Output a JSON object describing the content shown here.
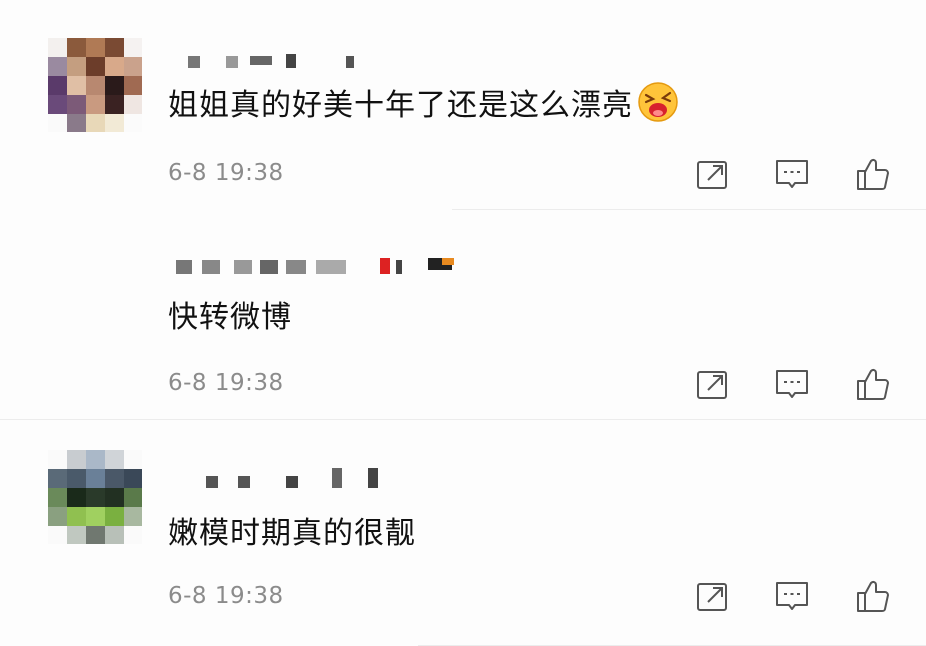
{
  "comments": [
    {
      "text": "姐姐真的好美十年了还是这么漂亮",
      "time": "6-8 19:38",
      "emoji": "laughing-face",
      "has_avatar": true
    },
    {
      "text": "快转微博",
      "time": "6-8 19:38",
      "has_avatar": false
    },
    {
      "text": "嫩模时期真的很靓",
      "time": "6-8 19:38",
      "has_avatar": true
    }
  ],
  "icons": {
    "share": "share-icon",
    "comment": "comment-icon",
    "like": "thumbs-up-icon"
  },
  "colors": {
    "time_text": "#8b8b8b",
    "icon_stroke": "#555555",
    "background": "#fdfdfd"
  }
}
